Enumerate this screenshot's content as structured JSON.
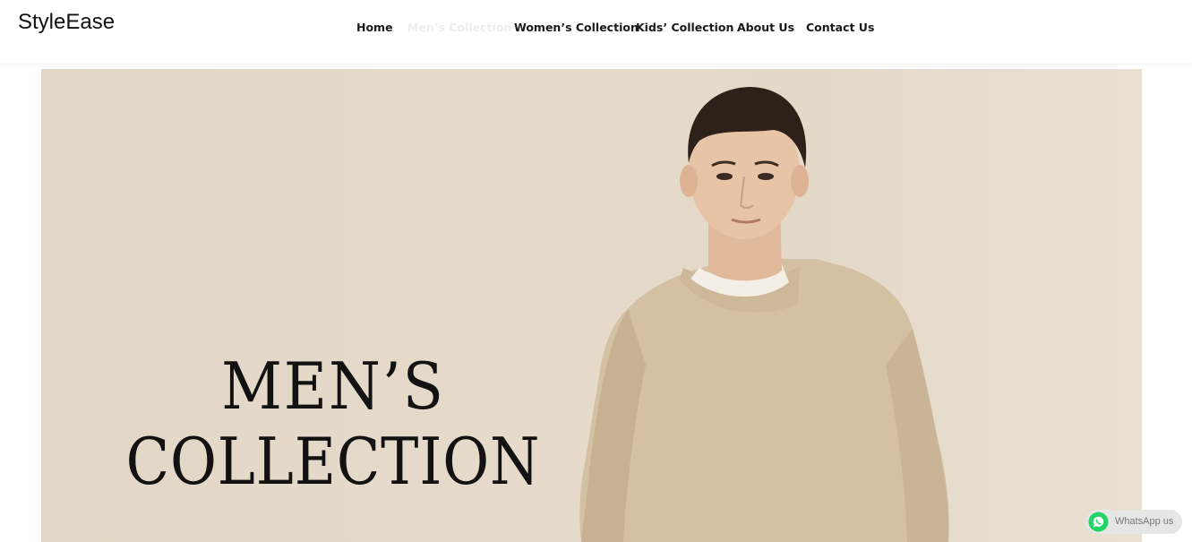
{
  "brand": {
    "name": "StyleEase"
  },
  "nav": {
    "items": [
      {
        "label": "Home"
      },
      {
        "label": "Men’s Collection"
      },
      {
        "label": "Women’s Collection"
      },
      {
        "label": "Kids’ Collection"
      },
      {
        "label": "About Us"
      },
      {
        "label": "Contact Us"
      }
    ],
    "active_index": 1
  },
  "hero": {
    "title_line1": "MEN’S",
    "title_line2": "COLLECTION",
    "image": "man-in-beige-sweatshirt"
  },
  "whatsapp": {
    "label": "WhatsApp us",
    "icon": "whatsapp-icon",
    "color": "#25D366"
  },
  "colors": {
    "hero_bg": "#e4d9c9",
    "text": "#111111",
    "sweater": "#d3bea0"
  }
}
